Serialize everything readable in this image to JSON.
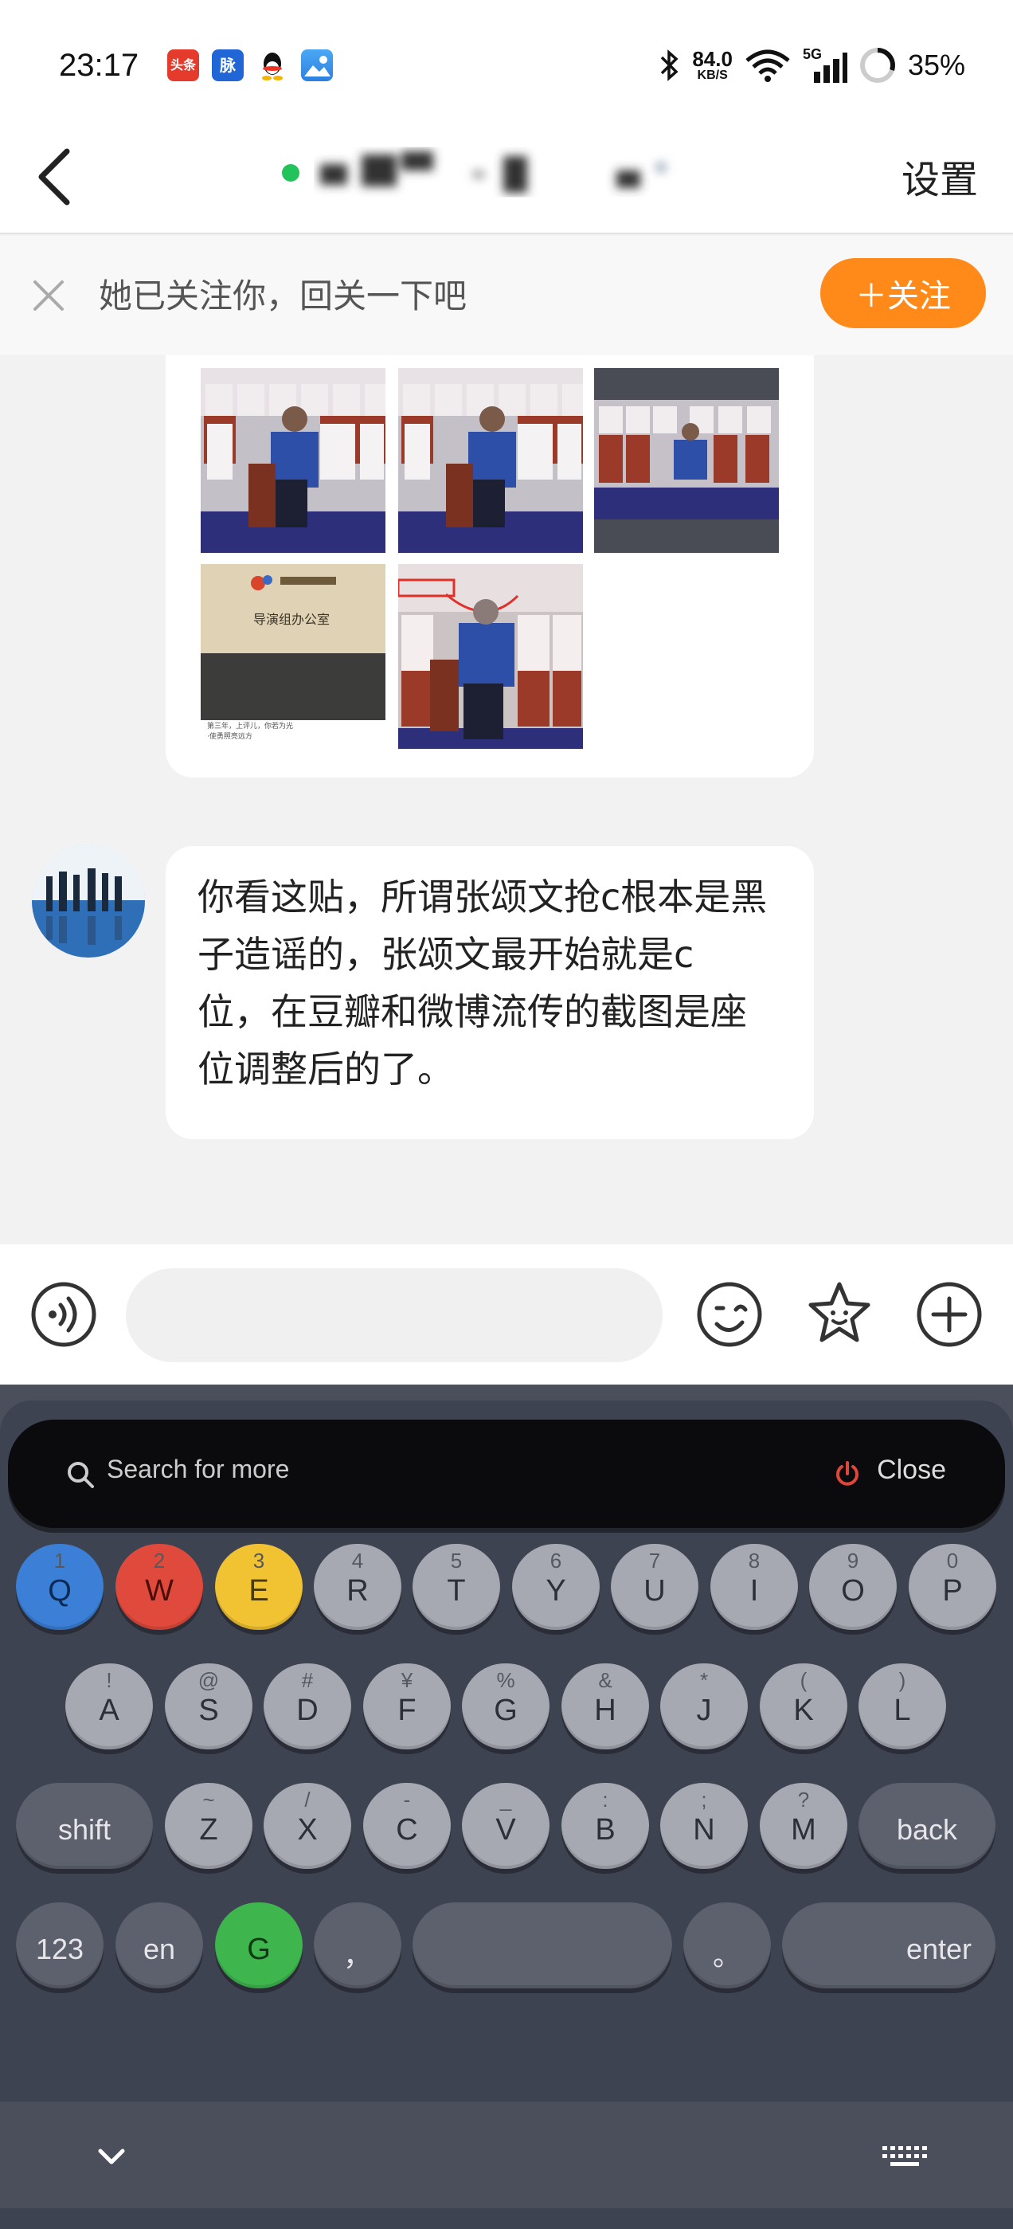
{
  "status_bar": {
    "time": "23:17",
    "app_icons": [
      "toutiao-icon",
      "maimai-icon",
      "qq-icon",
      "gallery-icon"
    ],
    "toutiao_label": "头条",
    "maimai_label": "脉",
    "net_speed_value": "84.0",
    "net_speed_unit": "KB/S",
    "signal_label": "5G",
    "battery": "35%"
  },
  "header": {
    "settings_label": "设置"
  },
  "follow_banner": {
    "text": "她已关注你，回关一下吧",
    "button_label": "＋关注"
  },
  "chat": {
    "image_captions": {
      "office_sign": "导演组办公室",
      "note": "第三年，上评儿，你若为光·使勇照亮远方"
    },
    "message": "你看这贴，所谓张颂文抢c根本是黑子造谣的，张颂文最开始就是c\n位，在豆瓣和微博流传的截图是座位调整后的了。"
  },
  "input_bar": {
    "placeholder": ""
  },
  "keyboard": {
    "search_text": "Search for more",
    "close_label": "Close",
    "row1": [
      {
        "main": "Q",
        "sub": "1"
      },
      {
        "main": "W",
        "sub": "2"
      },
      {
        "main": "E",
        "sub": "3"
      },
      {
        "main": "R",
        "sub": "4"
      },
      {
        "main": "T",
        "sub": "5"
      },
      {
        "main": "Y",
        "sub": "6"
      },
      {
        "main": "U",
        "sub": "7"
      },
      {
        "main": "I",
        "sub": "8"
      },
      {
        "main": "O",
        "sub": "9"
      },
      {
        "main": "P",
        "sub": "0"
      }
    ],
    "row2": [
      {
        "main": "A",
        "sub": "!"
      },
      {
        "main": "S",
        "sub": "@"
      },
      {
        "main": "D",
        "sub": "#"
      },
      {
        "main": "F",
        "sub": "¥"
      },
      {
        "main": "G",
        "sub": "%"
      },
      {
        "main": "H",
        "sub": "&"
      },
      {
        "main": "J",
        "sub": "*"
      },
      {
        "main": "K",
        "sub": "("
      },
      {
        "main": "L",
        "sub": ")"
      }
    ],
    "row3": [
      {
        "main": "Z",
        "sub": "~"
      },
      {
        "main": "X",
        "sub": "/"
      },
      {
        "main": "C",
        "sub": "-"
      },
      {
        "main": "V",
        "sub": "_"
      },
      {
        "main": "B",
        "sub": ":"
      },
      {
        "main": "N",
        "sub": ";"
      },
      {
        "main": "M",
        "sub": "?"
      }
    ],
    "shift_label": "shift",
    "back_label": "back",
    "num_label": "123",
    "lang_label": "en",
    "g_label": "G",
    "comma_label": "，",
    "period_label": "。",
    "enter_label": "enter"
  },
  "colors": {
    "follow_orange": "#ff8a1a",
    "online_green": "#22c35a",
    "key_blue": "#3b7fd6",
    "key_red": "#e04a3c",
    "key_yellow": "#f1c232",
    "key_green": "#3fb54e"
  }
}
